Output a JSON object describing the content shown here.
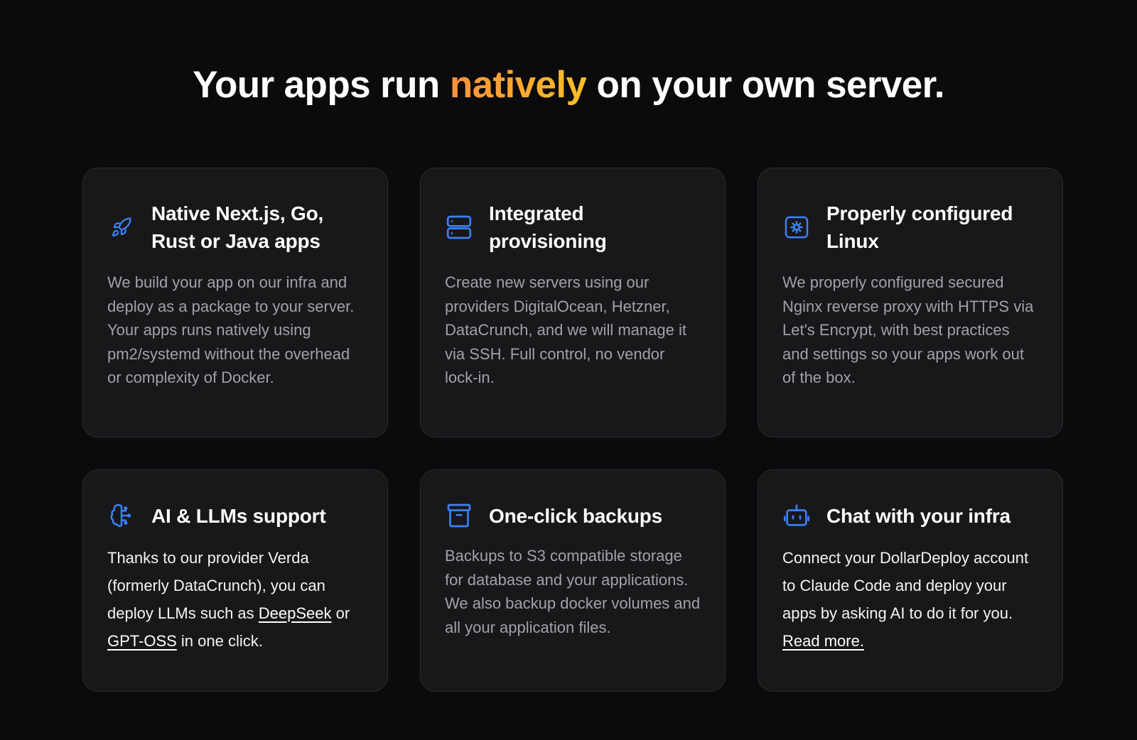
{
  "heading": {
    "before": "Your apps run ",
    "accent": "natively",
    "after": " on your own server."
  },
  "colors": {
    "icon": "#3b82f6",
    "accent_start": "#fb923c",
    "accent_end": "#fbbf24",
    "card_bg": "#18181b",
    "page_bg": "#0b0b0d"
  },
  "cards": [
    {
      "icon": "rocket-icon",
      "title_line1": "Native Next.js, Go,",
      "title_line2": "Rust or Java apps",
      "body": "We build your app on our infra and deploy as a package to your server. Your apps runs natively using pm2/systemd without the overhead or complexity of Docker."
    },
    {
      "icon": "server-icon",
      "title_line1": "Integrated",
      "title_line2": "provisioning",
      "body": "Create new servers using our providers DigitalOcean, Hetzner, DataCrunch, and we will manage it via SSH. Full control, no vendor lock-in."
    },
    {
      "icon": "settings-cog-icon",
      "title_line1": "Properly configured",
      "title_line2": "Linux",
      "body": "We properly configured secured Nginx reverse proxy with HTTPS via Let's Encrypt, with best practices and settings so your apps work out of the box."
    },
    {
      "icon": "brain-circuit-icon",
      "title": "AI & LLMs support",
      "body_pre": "Thanks to our provider Verda (formerly DataCrunch), you can deploy LLMs such as ",
      "link1": "DeepSeek",
      "body_mid": " or ",
      "link2": "GPT-OSS",
      "body_post": " in one click."
    },
    {
      "icon": "archive-box-icon",
      "title": "One-click backups",
      "body": "Backups to S3 compatible storage for database and your applications. We also backup docker volumes and all your application files."
    },
    {
      "icon": "robot-icon",
      "title": "Chat with your infra",
      "body_pre": "Connect your DollarDeploy account to Claude Code and deploy your apps by asking AI to do it for you. ",
      "link": "Read more."
    }
  ]
}
